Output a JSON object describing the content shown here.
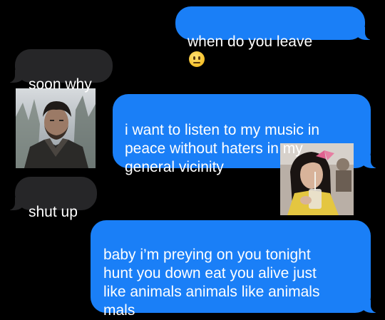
{
  "messages": [
    {
      "id": "b1",
      "direction": "sent",
      "text": "when do you leave",
      "emoji": "neutral-face"
    },
    {
      "id": "b2",
      "direction": "received",
      "text": "soon why"
    },
    {
      "id": "b3",
      "direction": "sent",
      "text": "i want to listen to my music in\npeace without haters in my\ngeneral vicinity"
    },
    {
      "id": "b4",
      "direction": "received",
      "text": "shut up"
    },
    {
      "id": "b5",
      "direction": "sent",
      "text": "baby i’m preying on you tonight\nhunt you down eat you alive just\nlike animals animals like animals\nmals"
    }
  ],
  "images": [
    {
      "id": "p1",
      "icon": "photo-man-snowy-forest"
    },
    {
      "id": "p2",
      "icon": "photo-woman-with-drink-straw"
    }
  ],
  "colors": {
    "background": "#000000",
    "sent_bubble": "#1a7ff7",
    "received_bubble": "#262628",
    "text": "#ffffff"
  }
}
